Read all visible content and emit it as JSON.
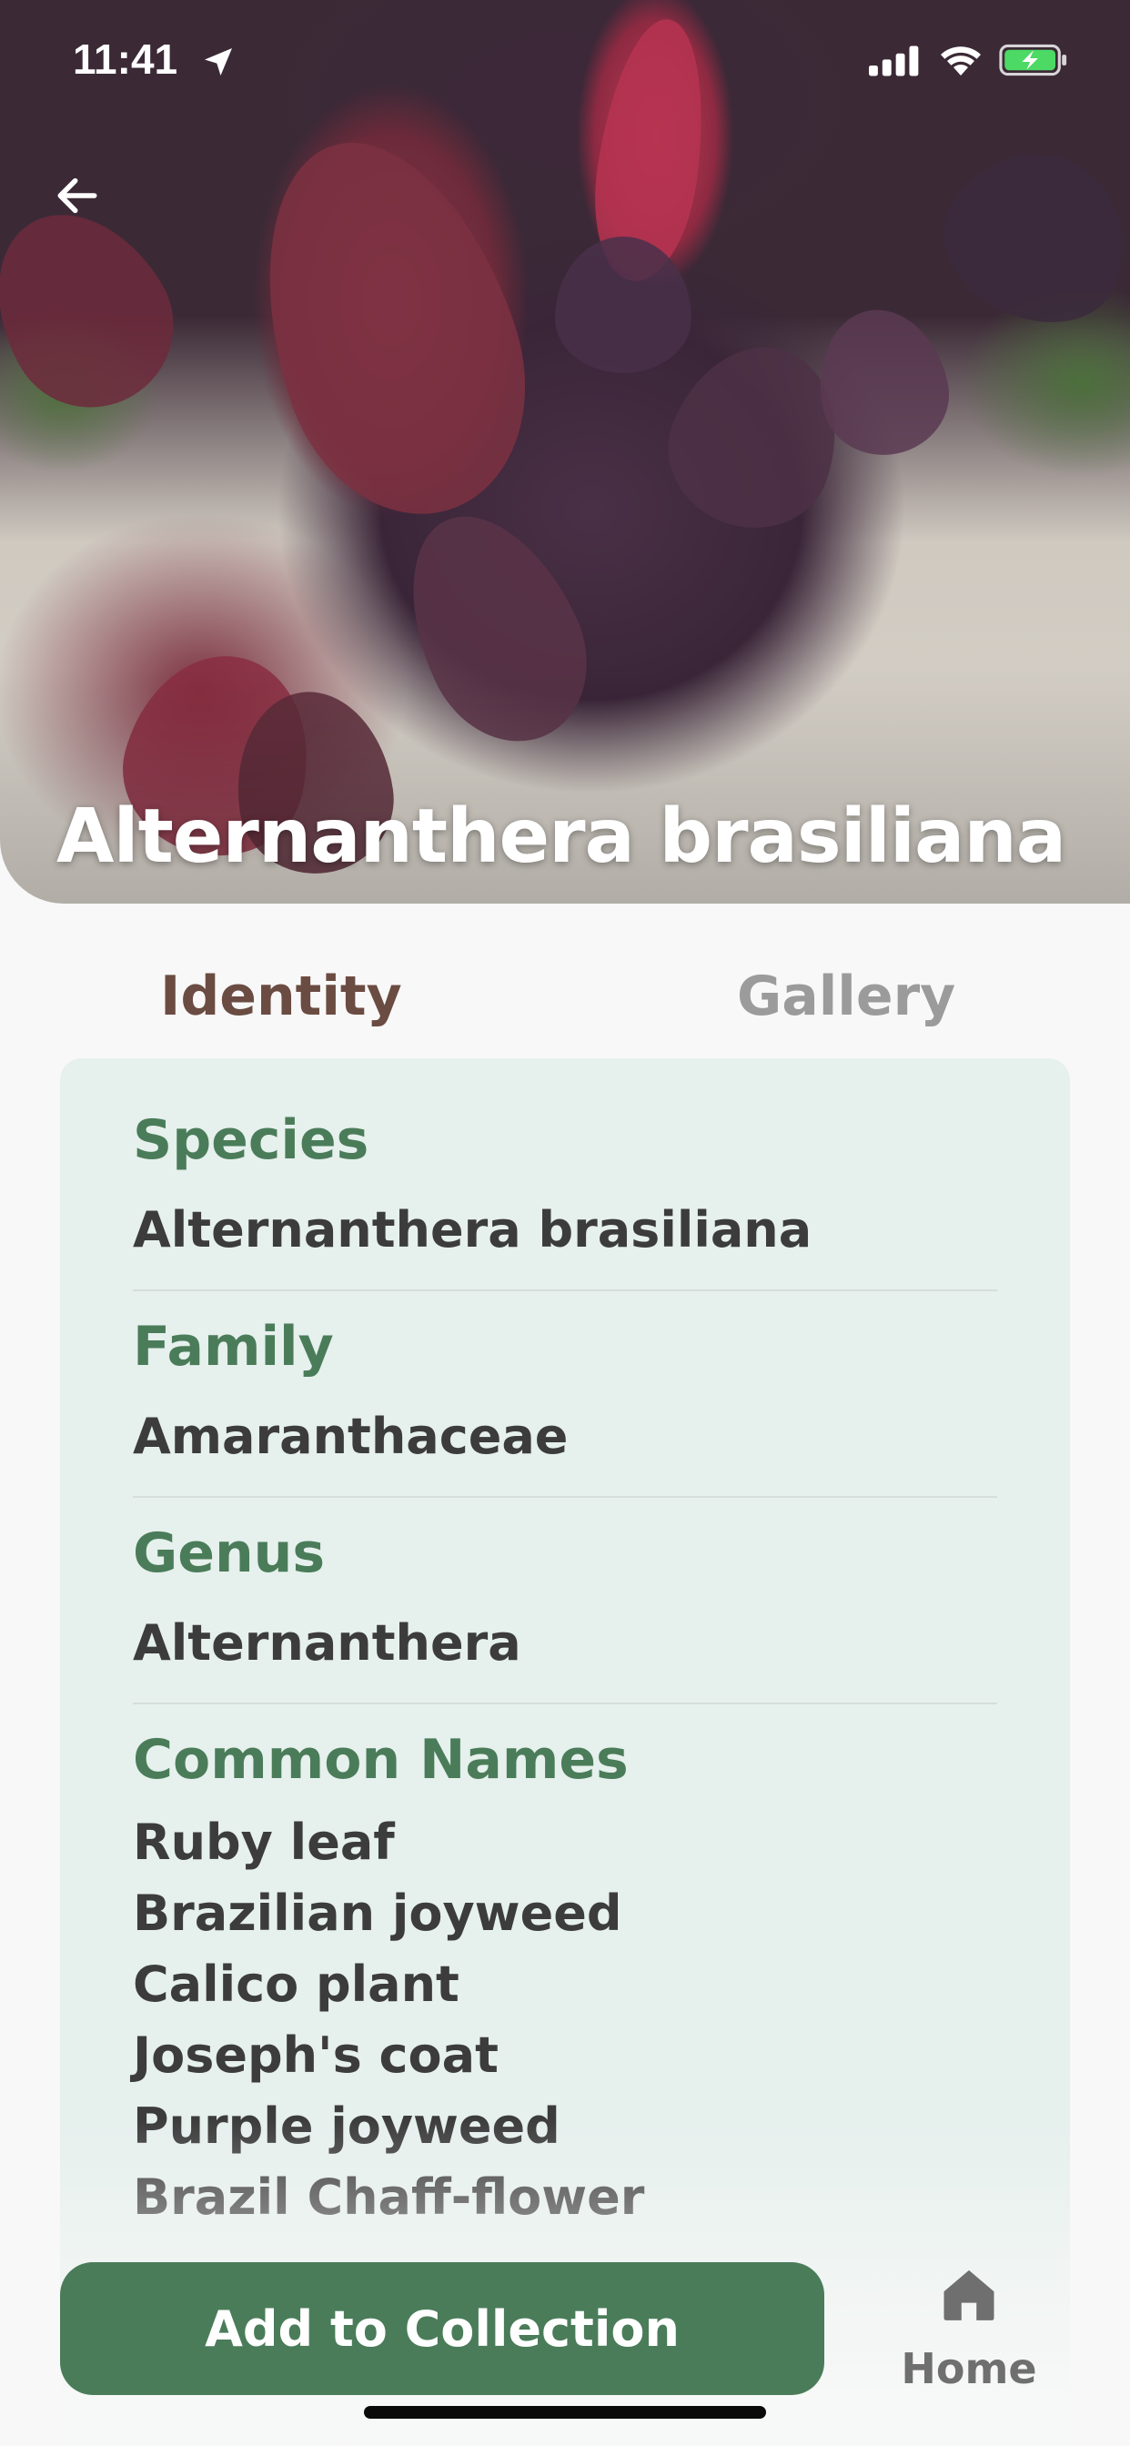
{
  "status_bar": {
    "time": "11:41"
  },
  "header": {
    "title": "Alternanthera brasiliana"
  },
  "tabs": [
    {
      "label": "Identity",
      "active": true
    },
    {
      "label": "Gallery",
      "active": false
    }
  ],
  "identity": {
    "species": {
      "label": "Species",
      "value": "Alternanthera brasiliana"
    },
    "family": {
      "label": "Family",
      "value": "Amaranthaceae"
    },
    "genus": {
      "label": "Genus",
      "value": "Alternanthera"
    },
    "common_names": {
      "label": "Common Names",
      "values": [
        "Ruby leaf",
        "Brazilian joyweed",
        "Calico plant",
        "Joseph's coat",
        "Purple joyweed",
        "Brazil Chaff-flower"
      ]
    }
  },
  "actions": {
    "add_to_collection": "Add to Collection"
  },
  "bottom_nav": {
    "home_label": "Home"
  },
  "colors": {
    "accent_green": "#4a7c59",
    "active_tab": "#6b4c42",
    "inactive_tab": "#9b9b9b",
    "card_background": "#e6f0ed",
    "value_text": "#3c3c3c"
  },
  "icons": [
    "location-arrow-icon",
    "signal-icon",
    "wifi-icon",
    "battery-charging-icon",
    "back-arrow-icon",
    "home-icon"
  ]
}
